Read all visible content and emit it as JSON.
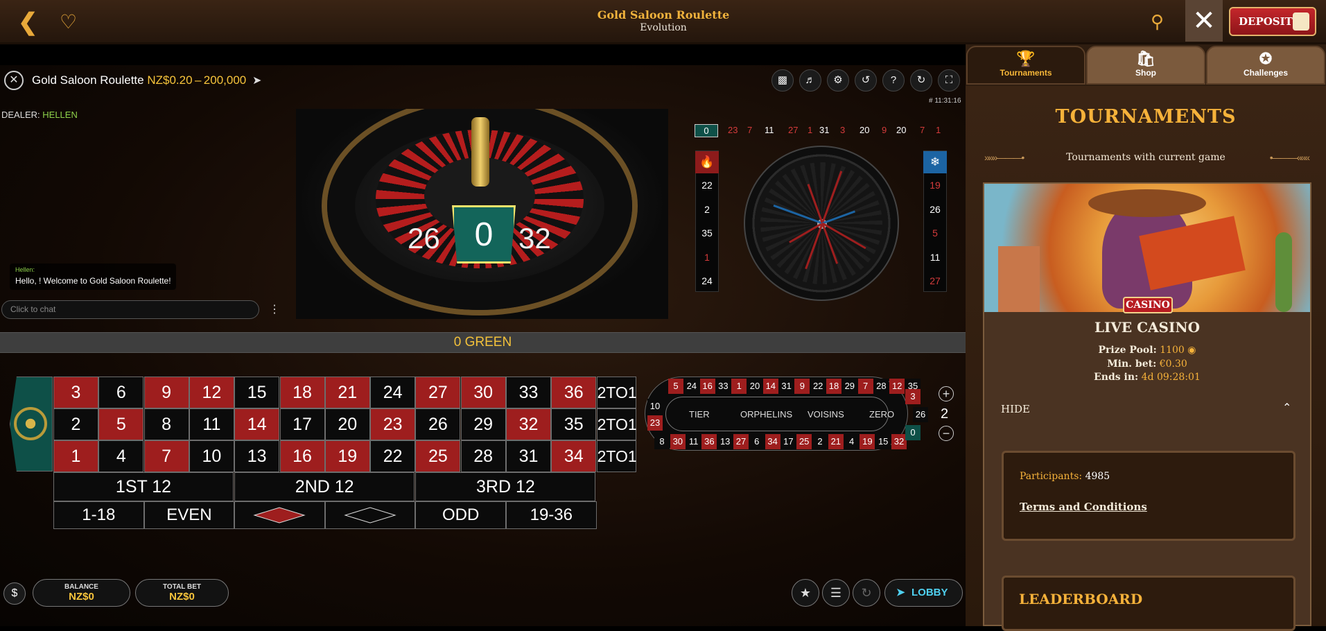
{
  "topbar": {
    "title": "Gold Saloon Roulette",
    "provider": "Evolution",
    "deposit_label": "DEPOSIT"
  },
  "game_header": {
    "name": "Gold Saloon Roulette",
    "limits": "NZ$0.20 – 200,000",
    "time": "# 11:31:16"
  },
  "dealer": {
    "label": "DEALER:",
    "name": "HELLEN"
  },
  "chat": {
    "sender": "Hellen:",
    "message": "Hello, ! Welcome to Gold Saloon Roulette!",
    "placeholder": "Click to chat"
  },
  "video_result": {
    "prev": "26",
    "current": "0",
    "next": "32"
  },
  "history": [
    {
      "n": "0",
      "c": "green"
    },
    {
      "n": "23",
      "c": "red"
    },
    {
      "n": "7",
      "c": "red"
    },
    {
      "n": "11",
      "c": "black"
    },
    {
      "n": "27",
      "c": "red"
    },
    {
      "n": "1",
      "c": "red"
    },
    {
      "n": "31",
      "c": "black"
    },
    {
      "n": "3",
      "c": "red"
    },
    {
      "n": "20",
      "c": "black"
    },
    {
      "n": "9",
      "c": "red"
    },
    {
      "n": "20",
      "c": "black"
    },
    {
      "n": "7",
      "c": "red"
    },
    {
      "n": "1",
      "c": "red"
    }
  ],
  "hot_numbers": [
    {
      "n": "22",
      "c": "black"
    },
    {
      "n": "2",
      "c": "black"
    },
    {
      "n": "35",
      "c": "black"
    },
    {
      "n": "1",
      "c": "red"
    },
    {
      "n": "24",
      "c": "black"
    }
  ],
  "cold_numbers": [
    {
      "n": "19",
      "c": "red"
    },
    {
      "n": "26",
      "c": "black"
    },
    {
      "n": "5",
      "c": "red"
    },
    {
      "n": "11",
      "c": "black"
    },
    {
      "n": "27",
      "c": "red"
    }
  ],
  "result_banner": "0 GREEN",
  "board": {
    "rows": [
      [
        {
          "n": "3",
          "c": "red"
        },
        {
          "n": "6",
          "c": "black"
        },
        {
          "n": "9",
          "c": "red"
        },
        {
          "n": "12",
          "c": "red"
        },
        {
          "n": "15",
          "c": "black"
        },
        {
          "n": "18",
          "c": "red"
        },
        {
          "n": "21",
          "c": "red"
        },
        {
          "n": "24",
          "c": "black"
        },
        {
          "n": "27",
          "c": "red"
        },
        {
          "n": "30",
          "c": "red"
        },
        {
          "n": "33",
          "c": "black"
        },
        {
          "n": "36",
          "c": "red"
        }
      ],
      [
        {
          "n": "2",
          "c": "black"
        },
        {
          "n": "5",
          "c": "red"
        },
        {
          "n": "8",
          "c": "black"
        },
        {
          "n": "11",
          "c": "black"
        },
        {
          "n": "14",
          "c": "red"
        },
        {
          "n": "17",
          "c": "black"
        },
        {
          "n": "20",
          "c": "black"
        },
        {
          "n": "23",
          "c": "red"
        },
        {
          "n": "26",
          "c": "black"
        },
        {
          "n": "29",
          "c": "black"
        },
        {
          "n": "32",
          "c": "red"
        },
        {
          "n": "35",
          "c": "black"
        }
      ],
      [
        {
          "n": "1",
          "c": "red"
        },
        {
          "n": "4",
          "c": "black"
        },
        {
          "n": "7",
          "c": "red"
        },
        {
          "n": "10",
          "c": "black"
        },
        {
          "n": "13",
          "c": "black"
        },
        {
          "n": "16",
          "c": "red"
        },
        {
          "n": "19",
          "c": "red"
        },
        {
          "n": "22",
          "c": "black"
        },
        {
          "n": "25",
          "c": "red"
        },
        {
          "n": "28",
          "c": "black"
        },
        {
          "n": "31",
          "c": "black"
        },
        {
          "n": "34",
          "c": "red"
        }
      ]
    ],
    "column_bet": "2TO1",
    "dozens": [
      "1ST 12",
      "2ND 12",
      "3RD 12"
    ],
    "outside": [
      "1-18",
      "EVEN",
      "",
      "",
      "ODD",
      "19-36"
    ]
  },
  "racetrack": {
    "top": [
      {
        "n": "5",
        "c": "red"
      },
      {
        "n": "24",
        "c": "black"
      },
      {
        "n": "16",
        "c": "red"
      },
      {
        "n": "33",
        "c": "black"
      },
      {
        "n": "1",
        "c": "red"
      },
      {
        "n": "20",
        "c": "black"
      },
      {
        "n": "14",
        "c": "red"
      },
      {
        "n": "31",
        "c": "black"
      },
      {
        "n": "9",
        "c": "red"
      },
      {
        "n": "22",
        "c": "black"
      },
      {
        "n": "18",
        "c": "red"
      },
      {
        "n": "29",
        "c": "black"
      },
      {
        "n": "7",
        "c": "red"
      },
      {
        "n": "28",
        "c": "black"
      },
      {
        "n": "12",
        "c": "red"
      },
      {
        "n": "35",
        "c": "black"
      }
    ],
    "bottom": [
      {
        "n": "8",
        "c": "black"
      },
      {
        "n": "30",
        "c": "red"
      },
      {
        "n": "11",
        "c": "black"
      },
      {
        "n": "36",
        "c": "red"
      },
      {
        "n": "13",
        "c": "black"
      },
      {
        "n": "27",
        "c": "red"
      },
      {
        "n": "6",
        "c": "black"
      },
      {
        "n": "34",
        "c": "red"
      },
      {
        "n": "17",
        "c": "black"
      },
      {
        "n": "25",
        "c": "red"
      },
      {
        "n": "2",
        "c": "black"
      },
      {
        "n": "21",
        "c": "red"
      },
      {
        "n": "4",
        "c": "black"
      },
      {
        "n": "19",
        "c": "red"
      },
      {
        "n": "15",
        "c": "black"
      },
      {
        "n": "32",
        "c": "red"
      }
    ],
    "left": [
      {
        "n": "10",
        "c": "black"
      },
      {
        "n": "23",
        "c": "red"
      }
    ],
    "right": [
      {
        "n": "3",
        "c": "red"
      },
      {
        "n": "26",
        "c": "black"
      },
      {
        "n": "0",
        "c": "green"
      }
    ],
    "labels": [
      "TIER",
      "ORPHELINS",
      "VOISINS",
      "ZERO"
    ],
    "neighbours": "2"
  },
  "bottom_bar": {
    "balance_label": "BALANCE",
    "balance_value": "NZ$0",
    "total_bet_label": "TOTAL BET",
    "total_bet_value": "NZ$0",
    "lobby_label": "LOBBY"
  },
  "sidebar": {
    "tabs": [
      "Tournaments",
      "Shop",
      "Challenges"
    ],
    "heading": "TOURNAMENTS",
    "subheading": "Tournaments with current game",
    "card": {
      "badge": "CASINO",
      "title": "LIVE CASINO",
      "prize_label": "Prize Pool:",
      "prize_value": "1100",
      "minbet_label": "Min. bet:",
      "minbet_value": "€0.30",
      "ends_label": "Ends in:",
      "ends_value": "4d 09:28:01",
      "hide_label": "HIDE",
      "participants_label": "Participants:",
      "participants_value": "4985",
      "terms": "Terms and Conditions"
    },
    "leaderboard": "LEADERBOARD"
  },
  "colors": {
    "accent": "#f6b23a",
    "red": "#9e1e1e",
    "green": "#0e5048",
    "dealer_name": "#8ed14a"
  }
}
